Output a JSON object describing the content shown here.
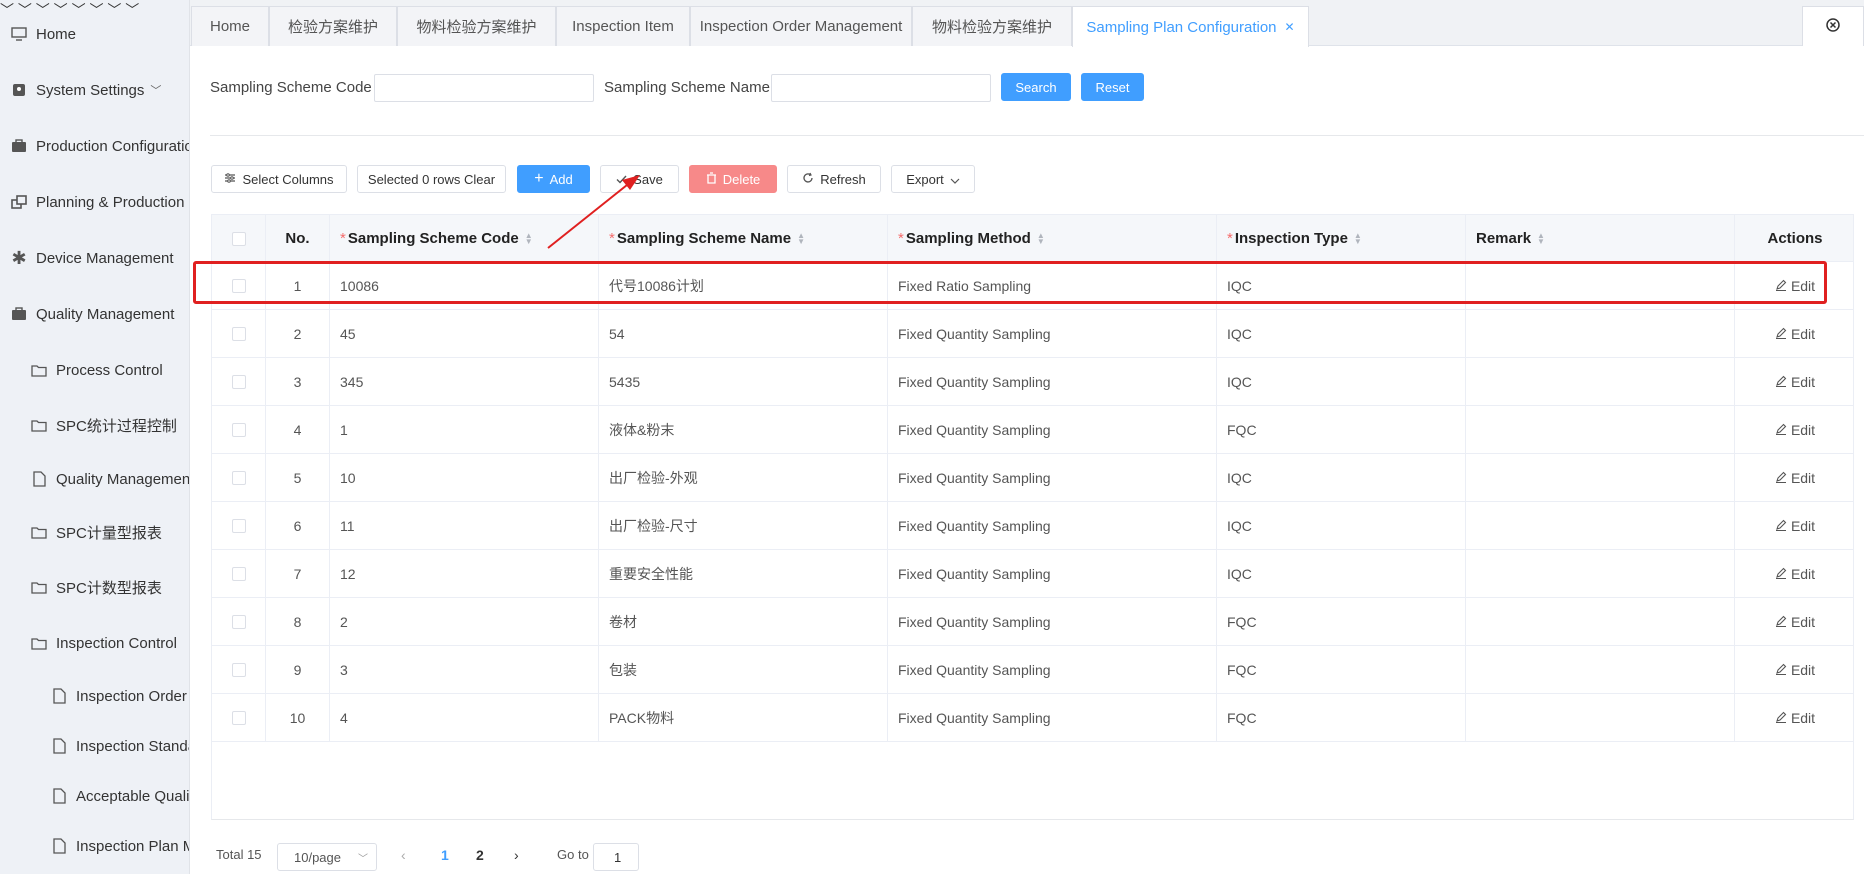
{
  "sidebar": {
    "items": [
      {
        "label": "Home",
        "icon": "monitor-icon"
      },
      {
        "label": "System Settings",
        "icon": "settings-icon"
      },
      {
        "label": "Production Configuration",
        "icon": "briefcase-icon"
      },
      {
        "label": "Planning & Production",
        "icon": "windows-icon"
      },
      {
        "label": "Device Management",
        "icon": "asterisk-icon"
      },
      {
        "label": "Quality Management",
        "icon": "briefcase-icon"
      },
      {
        "label": "Process Control",
        "icon": "folder-icon"
      },
      {
        "label": "SPC统计过程控制",
        "icon": "folder-icon"
      },
      {
        "label": "Quality Management I",
        "icon": "file-icon"
      },
      {
        "label": "SPC计量型报表",
        "icon": "folder-icon"
      },
      {
        "label": "SPC计数型报表",
        "icon": "folder-icon"
      },
      {
        "label": "Inspection Control",
        "icon": "folder-icon"
      },
      {
        "label": "Inspection Order M",
        "icon": "file-icon"
      },
      {
        "label": "Inspection Standar",
        "icon": "file-icon"
      },
      {
        "label": "Acceptable Quality",
        "icon": "file-icon"
      },
      {
        "label": "Inspection Plan Ma",
        "icon": "file-icon"
      }
    ]
  },
  "tabs": [
    {
      "label": "Home"
    },
    {
      "label": "检验方案维护"
    },
    {
      "label": "物料检验方案维护"
    },
    {
      "label": "Inspection Item"
    },
    {
      "label": "Inspection Order Management"
    },
    {
      "label": "物料检验方案维护"
    },
    {
      "label": "Sampling Plan Configuration",
      "active": true
    }
  ],
  "search": {
    "code_label": "Sampling Scheme Code",
    "code_value": "",
    "name_label": "Sampling Scheme Name",
    "name_value": "",
    "search_label": "Search",
    "reset_label": "Reset"
  },
  "toolbar": {
    "select_columns": "Select Columns",
    "selected_clear": "Selected 0 rows Clear",
    "add": "Add",
    "save": "Save",
    "delete": "Delete",
    "refresh": "Refresh",
    "export": "Export"
  },
  "table": {
    "columns": {
      "no": "No.",
      "code": "Sampling Scheme Code",
      "name": "Sampling Scheme Name",
      "method": "Sampling Method",
      "type": "Inspection Type",
      "remark": "Remark",
      "actions": "Actions"
    },
    "edit_label": "Edit",
    "rows": [
      {
        "no": "1",
        "code": "10086",
        "name": "代号10086计划",
        "method": "Fixed Ratio Sampling",
        "type": "IQC",
        "remark": ""
      },
      {
        "no": "2",
        "code": "45",
        "name": "54",
        "method": "Fixed Quantity Sampling",
        "type": "IQC",
        "remark": ""
      },
      {
        "no": "3",
        "code": "345",
        "name": "5435",
        "method": "Fixed Quantity Sampling",
        "type": "IQC",
        "remark": ""
      },
      {
        "no": "4",
        "code": "1",
        "name": "液体&粉末",
        "method": "Fixed Quantity Sampling",
        "type": "FQC",
        "remark": ""
      },
      {
        "no": "5",
        "code": "10",
        "name": "出厂检验-外观",
        "method": "Fixed Quantity Sampling",
        "type": "IQC",
        "remark": ""
      },
      {
        "no": "6",
        "code": "11",
        "name": "出厂检验-尺寸",
        "method": "Fixed Quantity Sampling",
        "type": "IQC",
        "remark": ""
      },
      {
        "no": "7",
        "code": "12",
        "name": "重要安全性能",
        "method": "Fixed Quantity Sampling",
        "type": "IQC",
        "remark": ""
      },
      {
        "no": "8",
        "code": "2",
        "name": "卷材",
        "method": "Fixed Quantity Sampling",
        "type": "FQC",
        "remark": ""
      },
      {
        "no": "9",
        "code": "3",
        "name": "包装",
        "method": "Fixed Quantity Sampling",
        "type": "FQC",
        "remark": ""
      },
      {
        "no": "10",
        "code": "4",
        "name": "PACK物料",
        "method": "Fixed Quantity Sampling",
        "type": "FQC",
        "remark": ""
      }
    ]
  },
  "pagination": {
    "total": "Total 15",
    "page_size": "10/page",
    "pages": [
      "1",
      "2"
    ],
    "current_page": "1",
    "goto_label": "Go to",
    "goto_value": "1"
  },
  "colors": {
    "primary": "#409eff",
    "danger": "#f78989",
    "annotation": "#e02020"
  }
}
